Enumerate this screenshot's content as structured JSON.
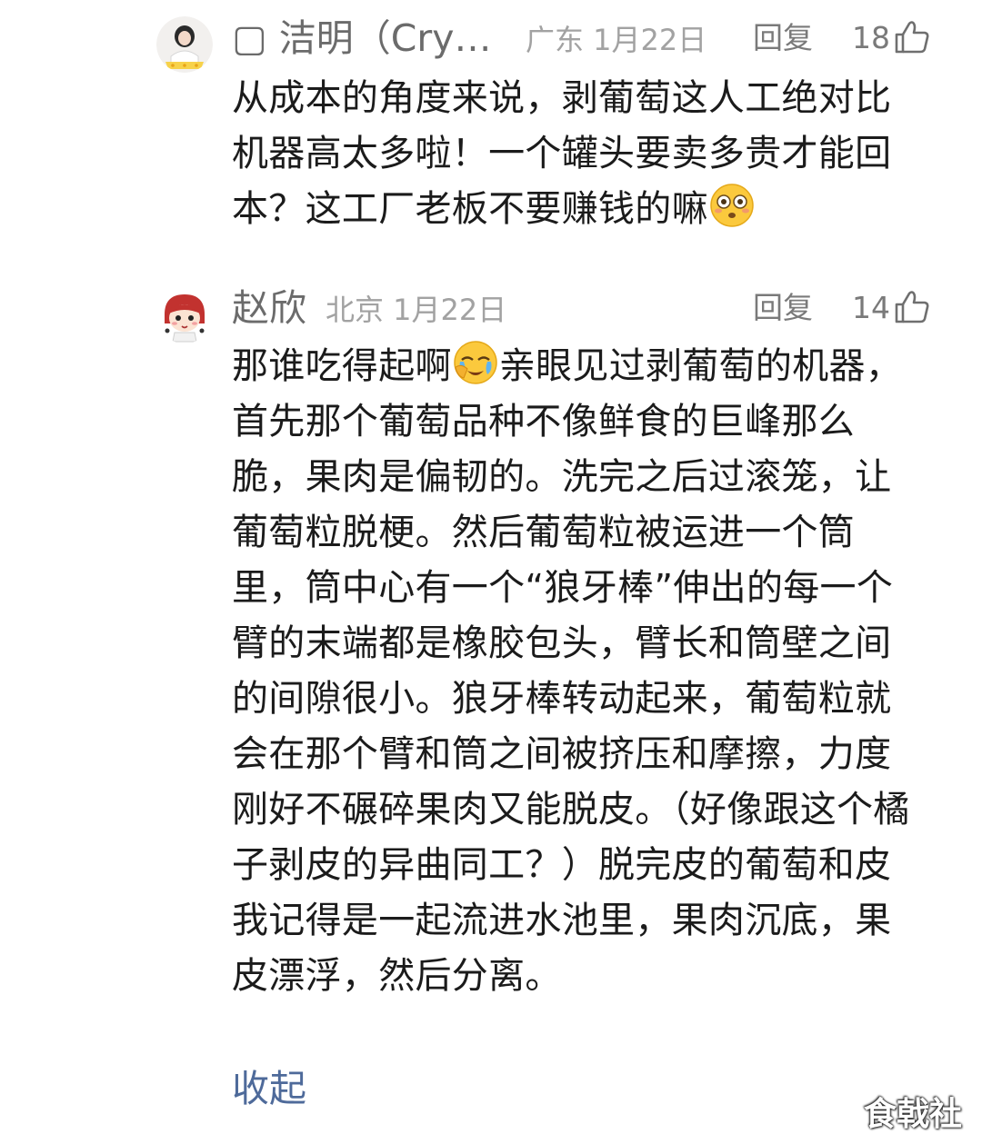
{
  "comments": [
    {
      "username": "▢ 洁明（Cry…",
      "location_date": "广东 1月22日",
      "reply_label": "回复",
      "like_count": "18",
      "text": "从成本的角度来说，剥葡萄这人工绝对比机器高太多啦！一个罐头要卖多贵才能回本？这工厂老板不要赚钱的嘛",
      "text_emoji": "flushed-face-emoji"
    },
    {
      "username": "赵欣",
      "location_date": "北京 1月22日",
      "reply_label": "回复",
      "like_count": "14",
      "text_before_emoji": "那谁吃得起啊",
      "text_emoji": "crying-face-emoji",
      "text_after_emoji": "亲眼见过剥葡萄的机器，首先那个葡萄品种不像鲜食的巨峰那么脆，果肉是偏韧的。洗完之后过滚笼，让葡萄粒脱梗。然后葡萄粒被运进一个筒里，筒中心有一个“狼牙棒”伸出的每一个臂的末端都是橡胶包头，臂长和筒壁之间的间隙很小。狼牙棒转动起来，葡萄粒就会在那个臂和筒之间被挤压和摩擦，力度刚好不碾碎果肉又能脱皮。（好像跟这个橘子剥皮的异曲同工？）脱完皮的葡萄和皮我记得是一起流进水池里，果肉沉底，果皮漂浮，然后分离。",
      "collapse_label": "收起"
    }
  ],
  "watermark": "食戟社",
  "colors": {
    "username": "#6b6b6b",
    "meta": "#a2a2a2",
    "body_text": "#1b1b1b",
    "link": "#4e6a9a"
  }
}
